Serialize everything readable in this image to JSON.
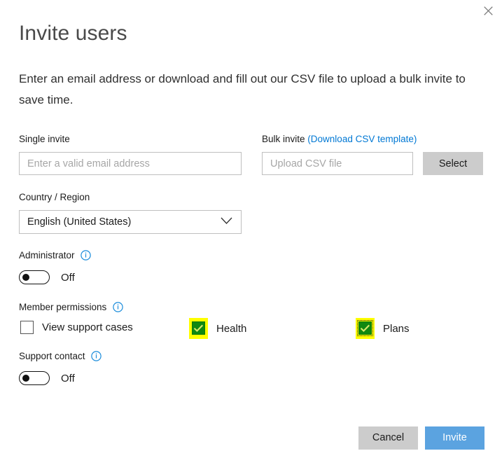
{
  "window": {
    "close_label": "Close",
    "close_icon": "close-icon"
  },
  "header": {
    "title": "Invite users",
    "description": "Enter an email address or download and fill out our CSV file to upload a bulk invite to save time."
  },
  "form": {
    "single_invite": {
      "label": "Single invite",
      "placeholder": "Enter a valid email address",
      "value": ""
    },
    "bulk_invite": {
      "label": "Bulk invite",
      "link_label": "(Download CSV template)",
      "placeholder": "Upload CSV file",
      "value": "",
      "select_button": "Select"
    },
    "country_region": {
      "label": "Country / Region",
      "value": "English (United States)",
      "chevron_icon": "chevron-down-icon"
    },
    "administrator": {
      "label": "Administrator",
      "info_icon": "info-icon",
      "state": "Off",
      "checked": false
    },
    "member_permissions": {
      "label": "Member permissions",
      "info_icon": "info-icon",
      "options": [
        {
          "label": "View support cases",
          "checked": false,
          "highlighted": false,
          "focused": false
        },
        {
          "label": "Health",
          "checked": true,
          "highlighted": true,
          "focused": false
        },
        {
          "label": "Plans",
          "checked": true,
          "highlighted": true,
          "focused": true
        }
      ]
    },
    "support_contact": {
      "label": "Support contact",
      "info_icon": "info-icon",
      "state": "Off",
      "checked": false
    }
  },
  "footer": {
    "cancel_label": "Cancel",
    "invite_label": "Invite"
  },
  "colors": {
    "link": "#0078d4",
    "primary_button": "#5ba3e0",
    "secondary_button": "#cccccc",
    "checkbox_checked": "#118811",
    "highlight": "#ffff00",
    "info_icon": "#1a8cdb"
  }
}
